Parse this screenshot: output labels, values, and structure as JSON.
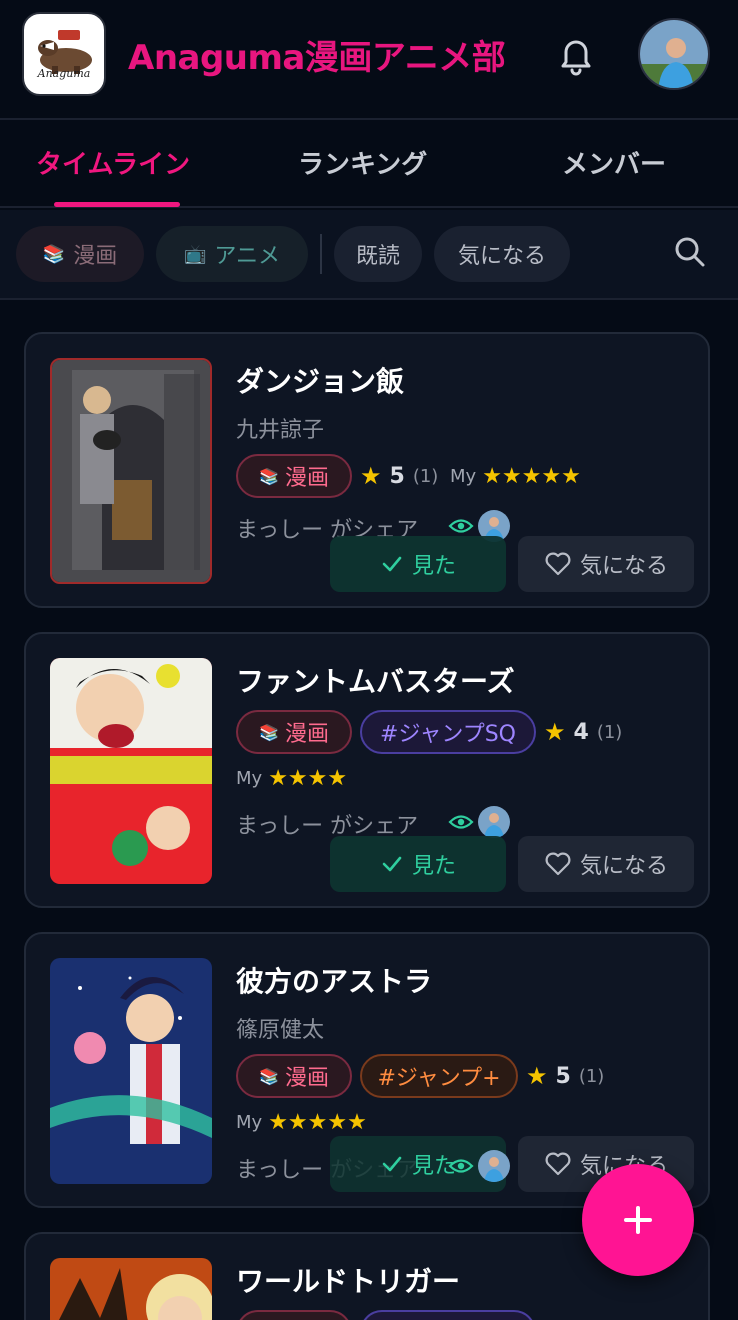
{
  "header": {
    "logo_text": "Anaguma",
    "title": "Anaguma漫画アニメ部"
  },
  "tabs": [
    {
      "label": "タイムライン",
      "active": true
    },
    {
      "label": "ランキング",
      "active": false
    },
    {
      "label": "メンバー",
      "active": false
    }
  ],
  "filters": {
    "manga": {
      "emoji": "📚",
      "label": "漫画"
    },
    "anime": {
      "emoji": "📺",
      "label": "アニメ"
    },
    "read": "既読",
    "want": "気になる"
  },
  "cards": [
    {
      "title": "ダンジョン飯",
      "author": "九井諒子",
      "tag": "漫画",
      "tag_emoji": "📚",
      "rating": "5",
      "rating_count": "(1)",
      "my_label": "My",
      "my_stars": "★★★★★",
      "share": "まっしー がシェア",
      "seen_label": "見た",
      "want_label": "気になる"
    },
    {
      "title": "ファントムバスターズ",
      "author": "",
      "tag": "漫画",
      "tag_emoji": "📚",
      "tag2": "#ジャンプSQ",
      "rating": "4",
      "rating_count": "(1)",
      "my_label": "My",
      "my_stars": "★★★★",
      "share": "まっしー がシェア",
      "seen_label": "見た",
      "want_label": "気になる"
    },
    {
      "title": "彼方のアストラ",
      "author": "篠原健太",
      "tag": "漫画",
      "tag_emoji": "📚",
      "tag2": "#ジャンプ+",
      "rating": "5",
      "rating_count": "(1)",
      "my_label": "My",
      "my_stars": "★★★★★",
      "share": "まっしー がシェア",
      "seen_label": "見た",
      "want_label": "気になる"
    },
    {
      "title": "ワールドトリガー"
    }
  ],
  "fab": "+",
  "colors": {
    "accent": "#f0177f",
    "background": "#050b16",
    "card": "#0e1523",
    "star": "#f5c400",
    "seen": "#2fcf9f"
  },
  "icons": [
    "bell-icon",
    "search-icon",
    "eye-icon",
    "check-icon",
    "heart-icon",
    "plus-icon"
  ]
}
